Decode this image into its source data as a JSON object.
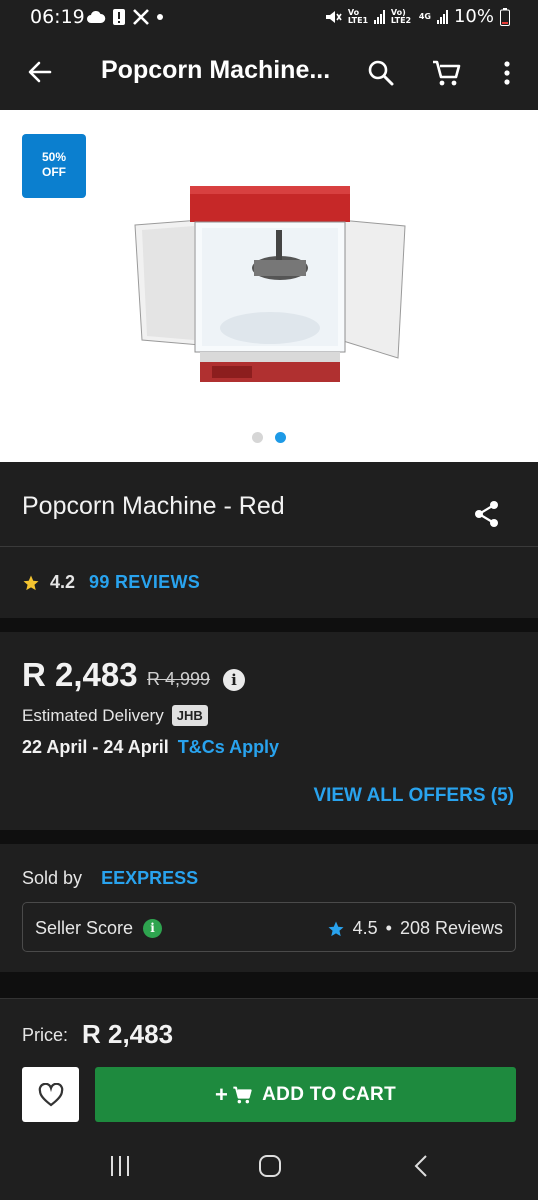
{
  "status_bar": {
    "time": "06:19",
    "battery": "10%",
    "net1": "Vo LTE1",
    "net2": "Vo) LTE2",
    "net_type": "4G"
  },
  "app_bar": {
    "title": "Popcorn Machine..."
  },
  "gallery": {
    "discount_badge_line1": "50%",
    "discount_badge_line2": "OFF",
    "image_count": 2,
    "active_index": 1
  },
  "product": {
    "title": "Popcorn Machine - Red",
    "rating": "4.2",
    "reviews_link": "99 REVIEWS",
    "price": "R 2,483",
    "old_price": "R 4,999",
    "estimated_delivery_label": "Estimated Delivery",
    "delivery_region": "JHB",
    "delivery_dates": "22 April - 24 April",
    "tcs_link": "T&Cs Apply",
    "offers_link": "VIEW ALL OFFERS (5)"
  },
  "seller": {
    "sold_by_label": "Sold by",
    "name": "EEXPRESS",
    "score_label": "Seller Score",
    "score": "4.5",
    "separator": "•",
    "reviews": "208 Reviews"
  },
  "bottom_bar": {
    "price_label": "Price:",
    "price": "R 2,483",
    "add_to_cart": "ADD TO CART",
    "plus": "+"
  },
  "colors": {
    "accent_blue": "#29a3ee",
    "cart_green": "#1e8a3e",
    "badge_blue": "#0b7fcf",
    "star_yellow": "#f4c430",
    "star_blue": "#29a3ee"
  }
}
